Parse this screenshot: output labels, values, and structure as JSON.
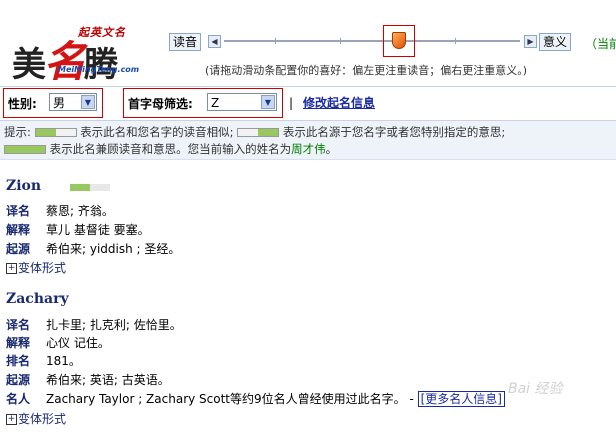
{
  "logo": {
    "main_a": "美",
    "main_b": "名",
    "main_c": "腾",
    "tagline": "起英文名",
    "url": "MeiMingTeng.com"
  },
  "slider": {
    "left_label": "读音",
    "right_label": "意义",
    "extra": "（当前",
    "hint": "(请拖动滑动条配置你的喜好：偏左更注重读音；偏右更注重意义。)",
    "position": 0.58
  },
  "filters": {
    "gender_label": "性别:",
    "gender_value": "男",
    "initial_label": "首字母筛选:",
    "initial_value": "Z",
    "separator": "|",
    "edit_link": "修改起名信息"
  },
  "tips": {
    "prefix": "提示:",
    "text1": "表示此名和您名字的读音相似;",
    "text2": "表示此名源于您名字或者您特别指定的意思;",
    "text3": "表示此名兼顾读音和意思。您当前输入的姓名为",
    "current_name": "周才伟",
    "end": "。"
  },
  "entries": [
    {
      "name": "Zion",
      "score": 0.5,
      "rows": [
        {
          "k": "译名",
          "v": "蔡恩; 齐翁。"
        },
        {
          "k": "解释",
          "v": "草儿 基督徒 要塞。"
        },
        {
          "k": "起源",
          "v": "希伯来; yiddish ; 圣经。"
        }
      ],
      "variant": "变体形式"
    },
    {
      "name": "Zachary",
      "rows": [
        {
          "k": "译名",
          "v": "扎卡里; 扎克利; 佐恰里。"
        },
        {
          "k": "解释",
          "v": "心仪 记住。"
        },
        {
          "k": "排名",
          "v": "181。"
        },
        {
          "k": "起源",
          "v": "希伯来; 英语; 古英语。"
        },
        {
          "k": "名人",
          "v": "Zachary Taylor ; Zachary Scott等约9位名人曾经使用过此名字。 - ",
          "more": "[更多名人信息]"
        }
      ],
      "variant": "变体形式"
    }
  ],
  "watermark": "Bai 经验"
}
